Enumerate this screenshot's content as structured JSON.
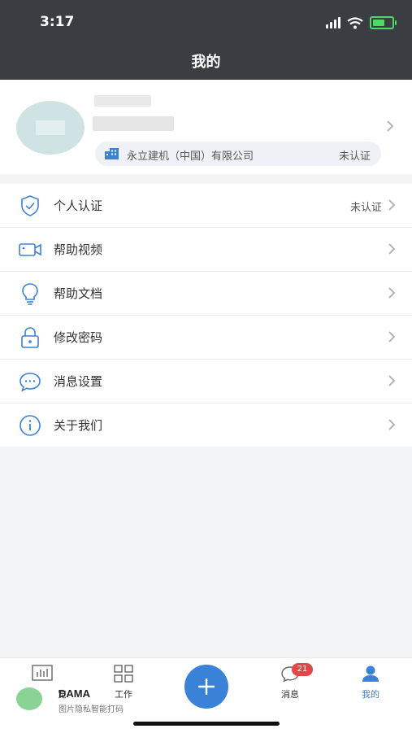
{
  "status_bar": {
    "time": "3:17"
  },
  "header": {
    "title": "我的"
  },
  "profile": {
    "company_name": "永立建机（中国）有限公司",
    "company_status": "未认证"
  },
  "menu": {
    "items": [
      {
        "label": "个人认证",
        "status": "未认证",
        "icon": "shield-icon"
      },
      {
        "label": "帮助视频",
        "status": "",
        "icon": "video-camera-icon"
      },
      {
        "label": "帮助文档",
        "status": "",
        "icon": "lightbulb-icon"
      },
      {
        "label": "修改密码",
        "status": "",
        "icon": "lock-icon"
      },
      {
        "label": "消息设置",
        "status": "",
        "icon": "chat-bubble-icon"
      },
      {
        "label": "关于我们",
        "status": "",
        "icon": "info-icon"
      }
    ]
  },
  "tabbar": {
    "overview_label": "览",
    "work_label": "工作",
    "messages_label": "消息",
    "messages_badge": "21",
    "mine_label": "我的"
  },
  "watermark": {
    "title": "DAMA",
    "subtitle": "图片隐私智能打码"
  },
  "colors": {
    "accent": "#3a82d7",
    "header_bg": "#3a3d42",
    "badge": "#e64545"
  }
}
